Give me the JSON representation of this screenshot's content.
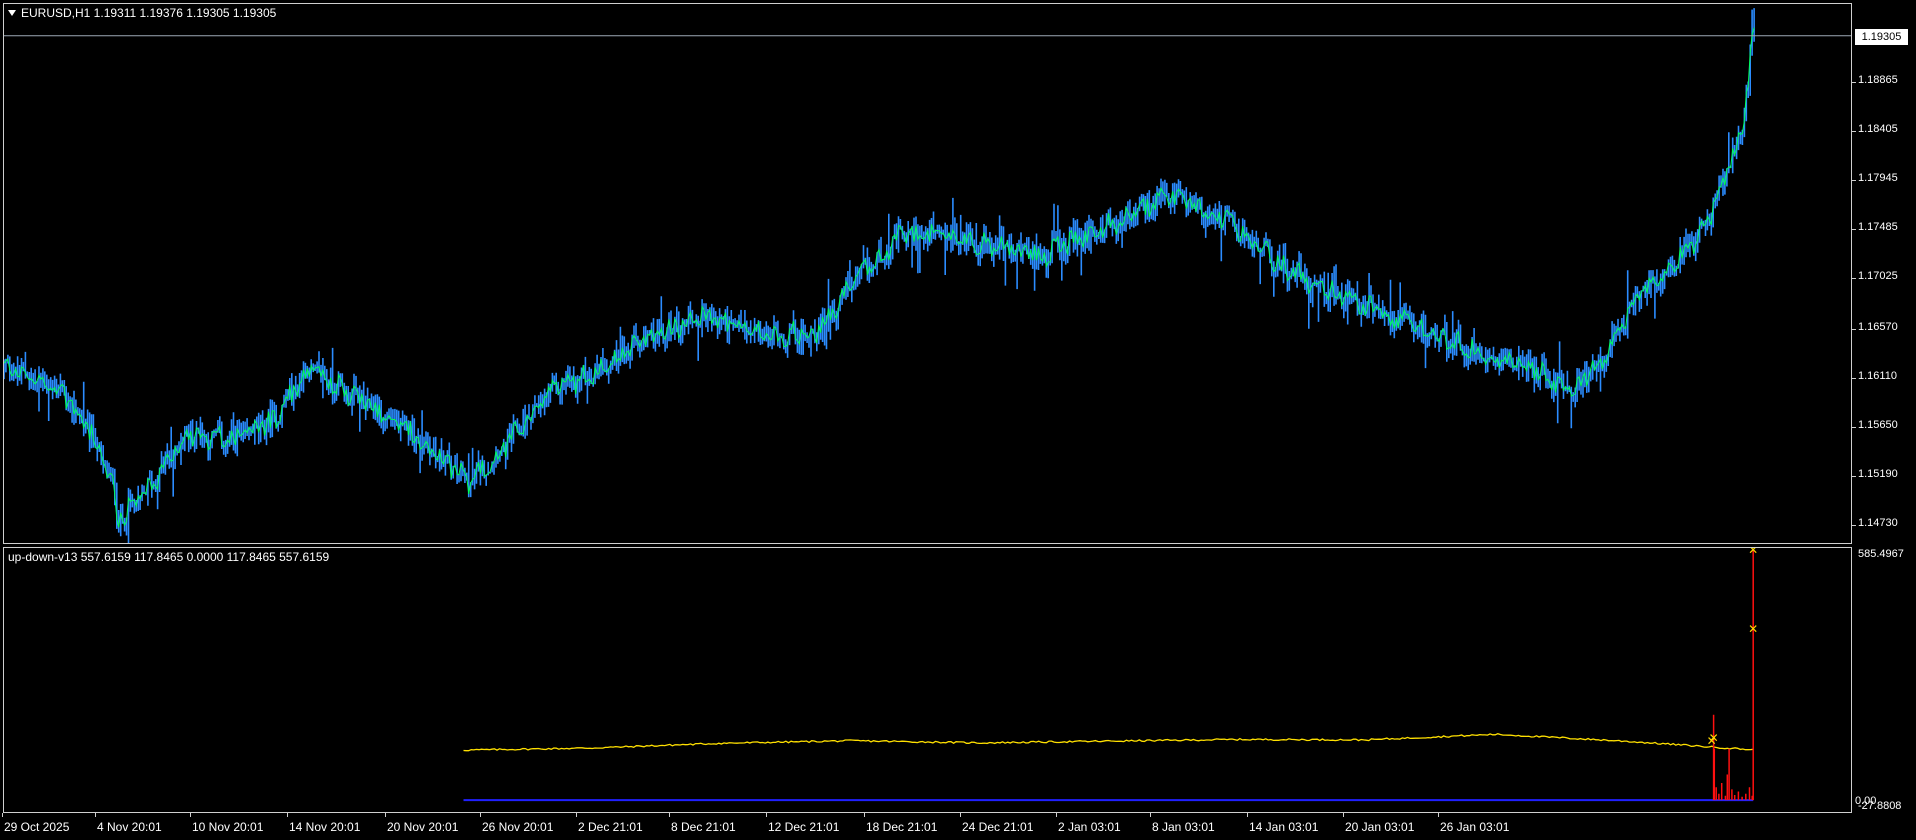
{
  "main_chart": {
    "title": "EURUSD,H1  1.19311 1.19376 1.19305 1.19305",
    "current_price": "1.19305",
    "price_labels": [
      "1.18865",
      "1.18405",
      "1.17945",
      "1.17485",
      "1.17025",
      "1.16570",
      "1.16110",
      "1.15650",
      "1.15190",
      "1.14730"
    ],
    "colors": {
      "candle_body": "#00ff5a",
      "candle_wick": "#2b8cff",
      "price_line": "#9ea9b5"
    }
  },
  "indicator": {
    "title": "up-down-v13 557.6159 117.8465 0.0000 117.8465 557.6159",
    "max_label": "585.4967",
    "min_label_a": "0.00",
    "min_label_b": "-27.8808",
    "colors": {
      "yellow_line": "#ffe000",
      "red_line": "#ff1010",
      "blue_line": "#2020ff",
      "marker": "#ffd700"
    }
  },
  "time_axis": {
    "labels": [
      "29 Oct 2025",
      "4 Nov 20:01",
      "10 Nov 20:01",
      "14 Nov 20:01",
      "20 Nov 20:01",
      "26 Nov 20:01",
      "2 Dec 21:01",
      "8 Dec 21:01",
      "12 Dec 21:01",
      "18 Dec 21:01",
      "24 Dec 21:01",
      "2 Jan 03:01",
      "8 Jan 03:01",
      "14 Jan 03:01",
      "20 Jan 03:01",
      "26 Jan 03:01"
    ]
  },
  "chart_data": {
    "type": "line",
    "series": [
      {
        "name": "EURUSD,H1",
        "x": [
          "29 Oct 2025",
          "4 Nov 20:01",
          "10 Nov 20:01",
          "14 Nov 20:01",
          "20 Nov 20:01",
          "26 Nov 20:01",
          "2 Dec 21:01",
          "8 Dec 21:01",
          "12 Dec 21:01",
          "18 Dec 21:01",
          "24 Dec 21:01",
          "2 Jan 03:01",
          "8 Jan 03:01",
          "14 Jan 03:01",
          "20 Jan 03:01",
          "26 Jan 03:01"
        ],
        "values": [
          1.1622,
          1.1478,
          1.1552,
          1.1596,
          1.1514,
          1.1611,
          1.167,
          1.1653,
          1.1745,
          1.1725,
          1.178,
          1.1712,
          1.1663,
          1.1625,
          1.1685,
          1.1931
        ]
      },
      {
        "name": "up-down-v13",
        "x": [
          "26 Nov 20:01",
          "2 Dec 21:01",
          "8 Dec 21:01",
          "12 Dec 21:01",
          "18 Dec 21:01",
          "24 Dec 21:01",
          "2 Jan 03:01",
          "8 Jan 03:01",
          "14 Jan 03:01",
          "20 Jan 03:01",
          "26 Jan 03:01"
        ],
        "values": [
          117,
          122,
          133,
          139,
          134,
          138,
          142,
          141,
          154,
          138,
          117.8465
        ]
      },
      {
        "name": "up-down-v13 spike",
        "x": [
          "26 Jan 03:01"
        ],
        "values": [
          585.4967
        ]
      }
    ],
    "ylim": [
      1.1458,
      1.1963
    ],
    "indicator_ylim": [
      -27.8808,
      585.4967
    ]
  }
}
